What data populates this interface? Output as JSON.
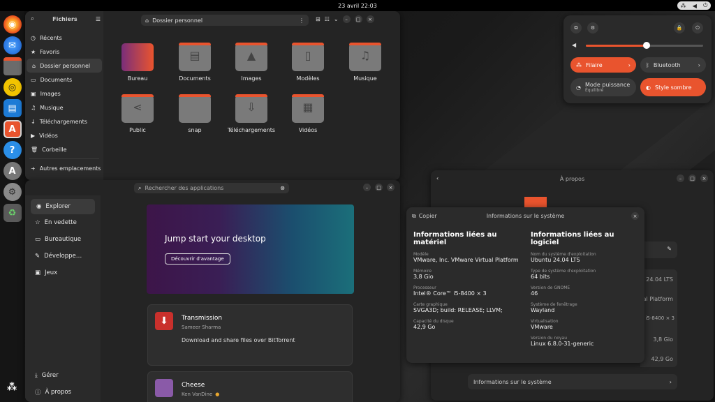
{
  "topbar": {
    "clock": "23 avril  22:03"
  },
  "dock": {
    "items": [
      "firefox",
      "thunderbird",
      "files",
      "rhythmbox",
      "writer",
      "app-center",
      "help",
      "updater",
      "settings",
      "trash",
      "show-apps"
    ]
  },
  "files": {
    "title": "Fichiers",
    "path": "Dossier personnel",
    "sidebar": [
      {
        "label": "Récents",
        "icon": "clock-icon"
      },
      {
        "label": "Favoris",
        "icon": "star-icon"
      },
      {
        "label": "Dossier personnel",
        "icon": "home-icon"
      },
      {
        "label": "Documents",
        "icon": "document-icon"
      },
      {
        "label": "Images",
        "icon": "image-icon"
      },
      {
        "label": "Musique",
        "icon": "music-icon"
      },
      {
        "label": "Téléchargements",
        "icon": "download-icon"
      },
      {
        "label": "Vidéos",
        "icon": "video-icon"
      },
      {
        "label": "Corbeille",
        "icon": "trash-icon"
      },
      {
        "label": "Autres emplacements",
        "icon": "plus-icon"
      }
    ],
    "folders": [
      "Bureau",
      "Documents",
      "Images",
      "Modèles",
      "Musique",
      "Public",
      "snap",
      "Téléchargements",
      "Vidéos"
    ]
  },
  "quick_settings": {
    "wired": "Filaire",
    "bluetooth": "Bluetooth",
    "power_mode": "Mode puissance",
    "power_value": "Équilibré",
    "dark_style": "Style sombre",
    "volume_level": 0.52
  },
  "appcenter": {
    "search_placeholder": "Rechercher des applications",
    "nav": [
      "Explorer",
      "En vedette",
      "Bureautique",
      "Développe…",
      "Jeux"
    ],
    "footer": [
      "Gérer",
      "À propos"
    ],
    "banner_title": "Jump start your desktop",
    "banner_button": "Découvrir d'avantage",
    "apps": [
      {
        "name": "Transmission",
        "author": "Sameer Sharma",
        "desc": "Download and share files over BitTorrent"
      },
      {
        "name": "Cheese",
        "author": "Ken VanDine",
        "desc": ""
      }
    ]
  },
  "about": {
    "title": "À propos",
    "rows": [
      "24.04 LTS",
      "al Platform",
      "i5-8400 × 3",
      "3,8 Gio",
      "42,9 Go"
    ],
    "system_info": "Informations sur le système"
  },
  "sysinfo": {
    "title": "Informations sur le système",
    "copy": "Copier",
    "hw_heading": "Informations liées au matériel",
    "sw_heading": "Informations liées au logiciel",
    "hw": [
      {
        "label": "Modèle",
        "value": "VMware, Inc. VMware Virtual Platform"
      },
      {
        "label": "Mémoire",
        "value": "3,8 Gio"
      },
      {
        "label": "Processeur",
        "value": "Intel® Core™ i5-8400 × 3"
      },
      {
        "label": "Carte graphique",
        "value": "SVGA3D; build: RELEASE; LLVM;"
      },
      {
        "label": "Capacité du disque",
        "value": "42,9 Go"
      }
    ],
    "sw": [
      {
        "label": "Nom du système d'exploitation",
        "value": "Ubuntu 24.04 LTS"
      },
      {
        "label": "Type de système d'exploitation",
        "value": "64 bits"
      },
      {
        "label": "Version de GNOME",
        "value": "46"
      },
      {
        "label": "Système de fenêtrage",
        "value": "Wayland"
      },
      {
        "label": "Virtualisation",
        "value": "VMware"
      },
      {
        "label": "Version du noyau",
        "value": "Linux 6.8.0-31-generic"
      }
    ]
  }
}
